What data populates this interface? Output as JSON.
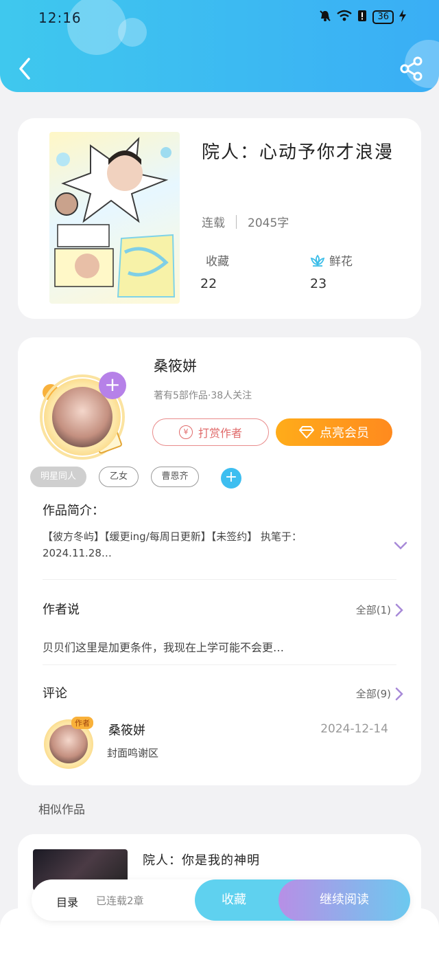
{
  "status_bar": {
    "time": "12:16",
    "battery": "36"
  },
  "book": {
    "title": "院人：心动予你才浪漫",
    "status": "连载",
    "word_count": "2045字",
    "favorites_label": "收藏",
    "favorites_value": "22",
    "flowers_label": "鲜花",
    "flowers_value": "23"
  },
  "author": {
    "name": "桑筱姘",
    "meta": "著有5部作品·38人关注",
    "tip_label": "打赏作者",
    "tip_icon_glyph": "¥",
    "vip_label": "点亮会员"
  },
  "tags": [
    "明星同人",
    "乙女",
    "曹恩齐"
  ],
  "intro": {
    "label": "作品简介：",
    "text": "【彼方冬屿】【缓更ing/每周日更新】【未签约】 执笔于：2024.11.28…"
  },
  "author_says": {
    "label": "作者说",
    "all_label": "全部(1)",
    "text": "贝贝们这里是加更条件，我现在上学可能不会更…"
  },
  "comments": {
    "label": "评论",
    "all_label": "全部(9)",
    "items": [
      {
        "badge": "作者",
        "name": "桑筱姘",
        "date": "2024-12-14",
        "text": "封面鸣谢区"
      }
    ]
  },
  "similar": {
    "heading": "相似作品",
    "items": [
      {
        "title": "院人：你是我的神明"
      }
    ]
  },
  "bottom_bar": {
    "toc_label": "目录",
    "chapters_label": "已连载2章",
    "favorite_label": "收藏",
    "read_label": "继续阅读"
  },
  "colors": {
    "header_start": "#3fc8ee",
    "header_end": "#3aaef5",
    "vip_orange": "#ff9a1e",
    "tip_red": "#e06a6a",
    "follow_purple": "#b681e8",
    "accent_blue": "#3dbef0"
  }
}
